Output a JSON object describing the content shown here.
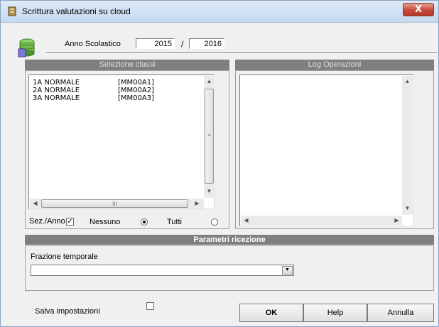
{
  "window": {
    "title": "Scrittura valutazioni su cloud",
    "close_label": "X"
  },
  "header": {
    "anno_label": "Anno Scolastico",
    "year_start": "2015",
    "separator": "/",
    "year_end": "2016"
  },
  "selezione": {
    "title": "Selezione classi",
    "classes": [
      {
        "name": "1A NORMALE",
        "code": "[MM00A1]"
      },
      {
        "name": "2A NORMALE",
        "code": "[MM00A2]"
      },
      {
        "name": "3A NORMALE",
        "code": "[MM00A3]"
      }
    ],
    "scroll_grip": "≡",
    "hscroll_grip": "III",
    "sez_anno_label": "Sez./Anno",
    "sez_anno_checked": true,
    "nessuno_label": "Nessuno",
    "nessuno_selected": true,
    "tutti_label": "Tutti",
    "tutti_selected": false
  },
  "log": {
    "title": "Log Operazioni"
  },
  "parametri": {
    "title": "Parametri ricezione",
    "frazione_label": "Frazione temporale",
    "frazione_value": ""
  },
  "footer": {
    "salva_label": "Salva impostazioni",
    "salva_checked": false,
    "ok_label": "OK",
    "help_label": "Help",
    "annulla_label": "Annulla"
  },
  "icons": {
    "app": "app-icon",
    "database": "database-icon",
    "close": "close-icon"
  },
  "colors": {
    "group_bar": "#7f7f7f",
    "close_red": "#c7493a",
    "window_bg": "#f0f0f0"
  }
}
